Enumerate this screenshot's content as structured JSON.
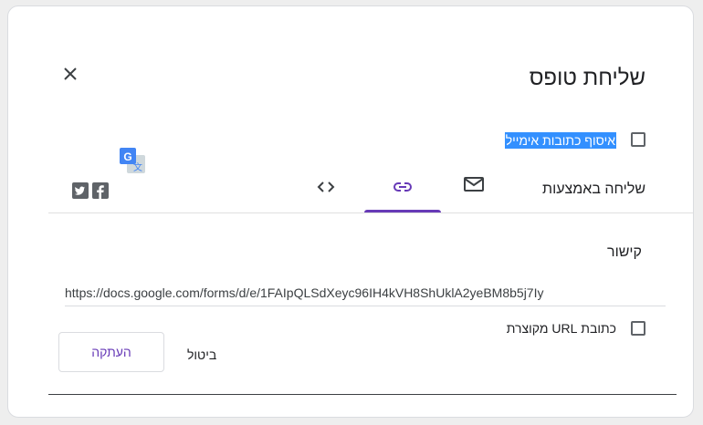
{
  "dialog": {
    "title": "שליחת טופס",
    "collect_emails_label": "איסוף כתובות אימייל",
    "send_via_label": "שליחה באמצעות"
  },
  "tabs": [
    {
      "icon": "email-icon",
      "selected": false
    },
    {
      "icon": "link-icon",
      "selected": true
    },
    {
      "icon": "embed-code-icon",
      "selected": false
    }
  ],
  "social": [
    "facebook-icon",
    "twitter-icon"
  ],
  "link_section": {
    "title": "קישור",
    "url": "https://docs.google.com/forms/d/e/1FAIpQLSdXeyc96IH4kVH8ShUklA2yeBM8b5j7Iy",
    "shorten_label": "כתובת URL מקוצרת"
  },
  "actions": {
    "cancel_label": "ביטול",
    "copy_label": "העתקה"
  },
  "colors": {
    "accent": "#673ab7",
    "selection": "#3390ff",
    "icon_gray": "#5f6368",
    "divider": "#e0e0e0"
  }
}
